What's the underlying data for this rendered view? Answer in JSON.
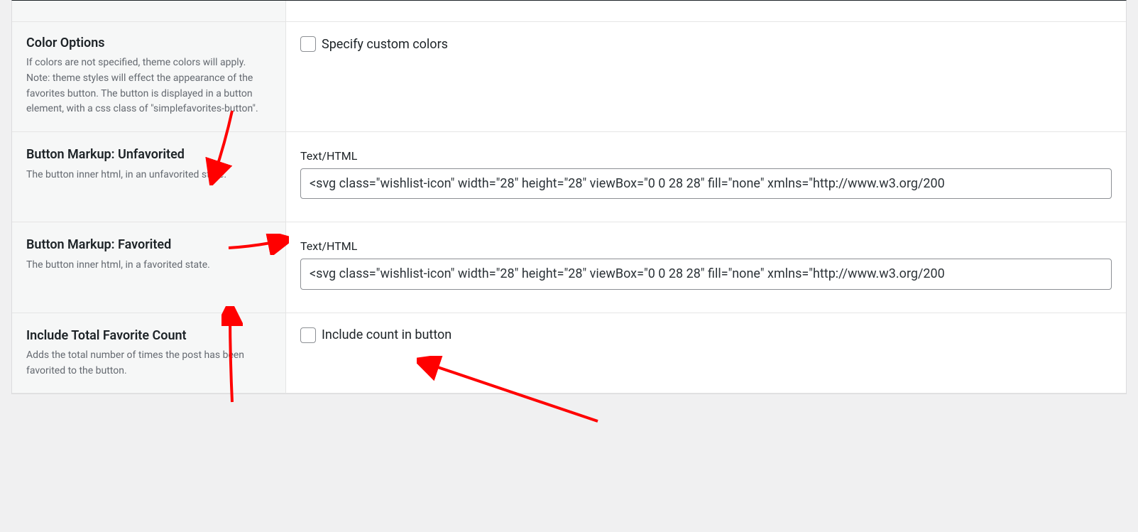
{
  "rows": {
    "color_options": {
      "heading": "Color Options",
      "description": "If colors are not specified, theme colors will apply. Note: theme styles will effect the appearance of the favorites button. The button is displayed in a button element, with a css class of \"simplefavorites-button\".",
      "checkbox_label": "Specify custom colors"
    },
    "unfavorited": {
      "heading": "Button Markup: Unfavorited",
      "description": "The button inner html, in an unfavorited state.",
      "field_label": "Text/HTML",
      "input_value": "<svg class=\"wishlist-icon\" width=\"28\" height=\"28\" viewBox=\"0 0 28 28\" fill=\"none\" xmlns=\"http://www.w3.org/200"
    },
    "favorited": {
      "heading": "Button Markup: Favorited",
      "description": "The button inner html, in a favorited state.",
      "field_label": "Text/HTML",
      "input_value": "<svg class=\"wishlist-icon\" width=\"28\" height=\"28\" viewBox=\"0 0 28 28\" fill=\"none\" xmlns=\"http://www.w3.org/200"
    },
    "include_count": {
      "heading": "Include Total Favorite Count",
      "description": "Adds the total number of times the post has been favorited to the button.",
      "checkbox_label": "Include count in button"
    }
  },
  "annotations": {
    "arrow_color": "#ff0000"
  }
}
